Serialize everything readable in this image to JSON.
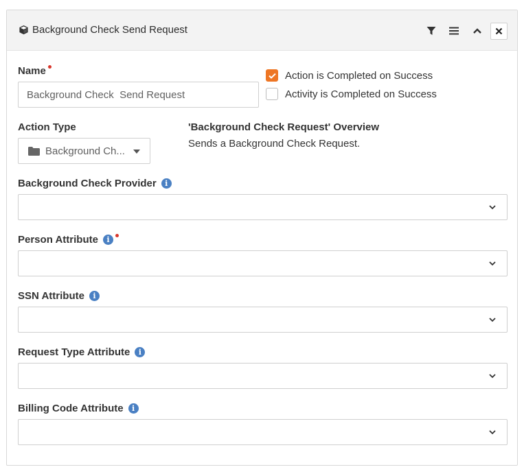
{
  "panel": {
    "title": "Background Check Send Request",
    "title_icon": "cube-icon",
    "header_buttons": [
      "filter-icon",
      "menu-icon",
      "chevron-up-icon",
      "close-icon"
    ]
  },
  "form": {
    "name_label": "Name",
    "name_value": "Background Check  Send Request",
    "action_completed_label": "Action is Completed on Success",
    "action_completed_checked": true,
    "activity_completed_label": "Activity is Completed on Success",
    "activity_completed_checked": false,
    "action_type_label": "Action Type",
    "action_type_value": "Background Ch...",
    "overview_title": "'Background Check Request' Overview",
    "overview_desc": "Sends a Background Check Request.",
    "provider_label": "Background Check Provider",
    "person_label": "Person Attribute",
    "ssn_label": "SSN Attribute",
    "request_type_label": "Request Type Attribute",
    "billing_label": "Billing Code Attribute",
    "provider_value": "",
    "person_value": "",
    "ssn_value": "",
    "request_type_value": "",
    "billing_value": ""
  },
  "colors": {
    "accent": "#ee7624",
    "info": "#4a80c3",
    "required": "#d9362b"
  }
}
